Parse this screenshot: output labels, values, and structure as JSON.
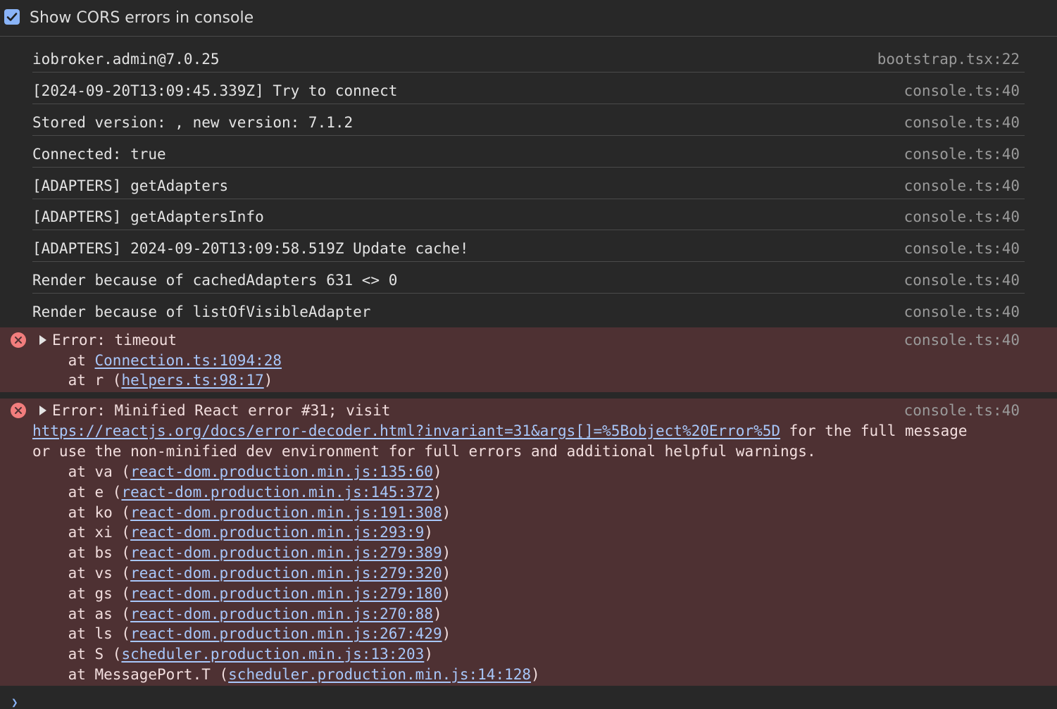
{
  "toolbar": {
    "checkbox_label": "Show CORS errors in console",
    "checkbox_checked": true
  },
  "messages": [
    {
      "text": "iobroker.admin@7.0.25",
      "source": "bootstrap.tsx:22"
    },
    {
      "text": "[2024-09-20T13:09:45.339Z] Try to connect",
      "source": "console.ts:40"
    },
    {
      "text": "Stored version: , new version: 7.1.2",
      "source": "console.ts:40"
    },
    {
      "text": "Connected: true",
      "source": "console.ts:40"
    },
    {
      "text": "[ADAPTERS] getAdapters",
      "source": "console.ts:40"
    },
    {
      "text": "[ADAPTERS] getAdaptersInfo",
      "source": "console.ts:40"
    },
    {
      "text": "[ADAPTERS] 2024-09-20T13:09:58.519Z Update cache!",
      "source": "console.ts:40"
    },
    {
      "text": "Render because of cachedAdapters 631 <> 0",
      "source": "console.ts:40"
    },
    {
      "text": "Render because of listOfVisibleAdapter",
      "source": "console.ts:40"
    }
  ],
  "errors": [
    {
      "title": "Error: timeout",
      "source": "console.ts:40",
      "stack1_prefix": "    at ",
      "stack1_link": "Connection.ts:1094:28",
      "stack1_suffix": "",
      "stack2_prefix": "    at r (",
      "stack2_link": "helpers.ts:98:17",
      "stack2_suffix": ")"
    },
    {
      "title": "Error: Minified React error #31; visit",
      "source": "console.ts:40",
      "url": "https://reactjs.org/docs/error-decoder.html?invariant=31&args[]=%5Bobject%20Error%5D",
      "url_suffix": " for the full message",
      "line3": "or use the non-minified dev environment for full errors and additional helpful warnings.",
      "stack": [
        {
          "prefix": "    at va (",
          "link": "react-dom.production.min.js:135:60",
          "suffix": ")"
        },
        {
          "prefix": "    at e (",
          "link": "react-dom.production.min.js:145:372",
          "suffix": ")"
        },
        {
          "prefix": "    at ko (",
          "link": "react-dom.production.min.js:191:308",
          "suffix": ")"
        },
        {
          "prefix": "    at xi (",
          "link": "react-dom.production.min.js:293:9",
          "suffix": ")"
        },
        {
          "prefix": "    at bs (",
          "link": "react-dom.production.min.js:279:389",
          "suffix": ")"
        },
        {
          "prefix": "    at vs (",
          "link": "react-dom.production.min.js:279:320",
          "suffix": ")"
        },
        {
          "prefix": "    at gs (",
          "link": "react-dom.production.min.js:279:180",
          "suffix": ")"
        },
        {
          "prefix": "    at as (",
          "link": "react-dom.production.min.js:270:88",
          "suffix": ")"
        },
        {
          "prefix": "    at ls (",
          "link": "react-dom.production.min.js:267:429",
          "suffix": ")"
        },
        {
          "prefix": "    at S (",
          "link": "scheduler.production.min.js:13:203",
          "suffix": ")"
        },
        {
          "prefix": "    at MessagePort.T (",
          "link": "scheduler.production.min.js:14:128",
          "suffix": ")"
        }
      ]
    }
  ],
  "colors": {
    "background": "#282828",
    "error_background": "#4e3133",
    "error_icon": "#f27d7d",
    "link": "#a8c7fa",
    "checkbox": "#8ab4f8"
  },
  "icons": {
    "checkbox": "checkmark-icon",
    "error": "error-x-icon",
    "expand": "expand-triangle-icon",
    "prompt": "prompt-chevron-icon"
  }
}
